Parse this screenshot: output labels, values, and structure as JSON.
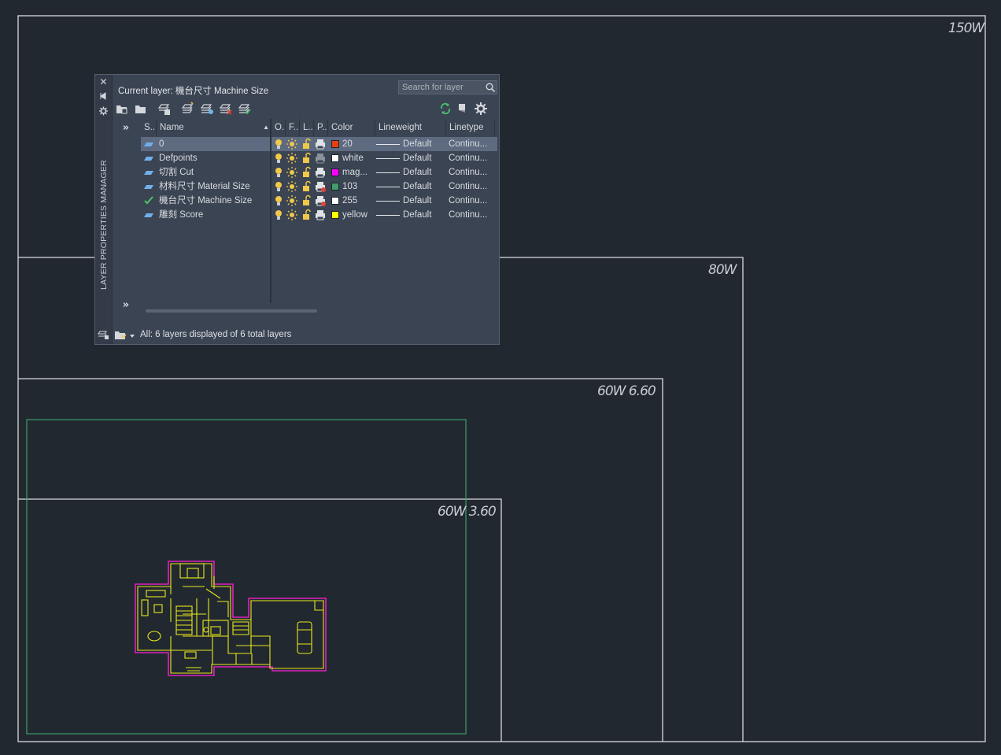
{
  "sheets": [
    {
      "label": "150W"
    },
    {
      "label": "80W"
    },
    {
      "label": "60W 6.60"
    },
    {
      "label": "60W 3.60"
    }
  ],
  "palette": {
    "side_title": "LAYER PROPERTIES MANAGER",
    "current_layer_label": "Current layer: 機台尺寸 Machine Size",
    "search_placeholder": "Search for layer",
    "columns": {
      "status": "S..",
      "name": "Name",
      "on": "O..",
      "freeze": "F..",
      "lock": "L..",
      "plot": "P..",
      "color": "Color",
      "lineweight": "Lineweight",
      "linetype": "Linetype"
    },
    "layers": [
      {
        "name": "0",
        "status_icon": "layer-parallelogram-icon",
        "color_name": "20",
        "color_hex": "#e8400c",
        "lineweight": "Default",
        "linetype": "Continu...",
        "plot_icon": "printer-icon",
        "selected": true
      },
      {
        "name": "Defpoints",
        "status_icon": "layer-parallelogram-icon",
        "color_name": "white",
        "color_hex": "#ffffff",
        "lineweight": "Default",
        "linetype": "Continu...",
        "plot_icon": "printer-disabled-icon",
        "selected": false
      },
      {
        "name": "切割 Cut",
        "status_icon": "layer-parallelogram-icon",
        "color_name": "mag...",
        "color_hex": "#ff00ff",
        "lineweight": "Default",
        "linetype": "Continu...",
        "plot_icon": "printer-icon",
        "selected": false
      },
      {
        "name": "材料尺寸  Material Size",
        "status_icon": "layer-parallelogram-icon",
        "color_name": "103",
        "color_hex": "#3f9d6a",
        "lineweight": "Default",
        "linetype": "Continu...",
        "plot_icon": "printer-no-plot-icon",
        "selected": false
      },
      {
        "name": "機台尺寸  Machine Size",
        "status_icon": "current-checkmark-icon",
        "color_name": "255",
        "color_hex": "#ffffff",
        "lineweight": "Default",
        "linetype": "Continu...",
        "plot_icon": "printer-no-plot-icon",
        "selected": false
      },
      {
        "name": "雕刻 Score",
        "status_icon": "layer-parallelogram-icon",
        "color_name": "yellow",
        "color_hex": "#ffff00",
        "lineweight": "Default",
        "linetype": "Continu...",
        "plot_icon": "printer-icon",
        "selected": false
      }
    ],
    "status_text": "All: 6 layers displayed of 6 total layers"
  }
}
